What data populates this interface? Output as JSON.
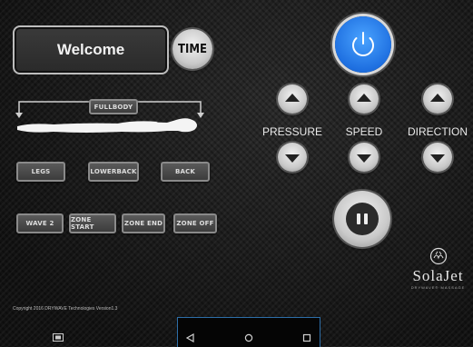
{
  "header": {
    "welcome_label": "Welcome",
    "time_label": "TIME"
  },
  "body_zone": {
    "fullbody_label": "FULLBODY",
    "zones": [
      "LEGS",
      "LOWERBACK",
      "BACK"
    ]
  },
  "modes": [
    "WAVE 2",
    "ZONE START",
    "ZONE END",
    "ZONE OFF"
  ],
  "controls": [
    {
      "label": "PRESSURE"
    },
    {
      "label": "SPEED"
    },
    {
      "label": "DIRECTION"
    }
  ],
  "logo": {
    "name": "SolaJet",
    "tagline": "DRYWAVE® MASSAGE"
  },
  "footer": {
    "copyright": "Copyright 2016 DRYWAVE Technologies Version1.3"
  },
  "icons": {
    "power": "power-icon",
    "pause": "pause-icon",
    "back": "nav-back-icon",
    "home": "nav-home-icon",
    "recents": "nav-recents-icon",
    "screenshot": "screenshot-icon"
  },
  "colors": {
    "power_blue": "#1e6fe0",
    "nav_border": "#2d6ea8",
    "background": "#1c1c1c"
  }
}
